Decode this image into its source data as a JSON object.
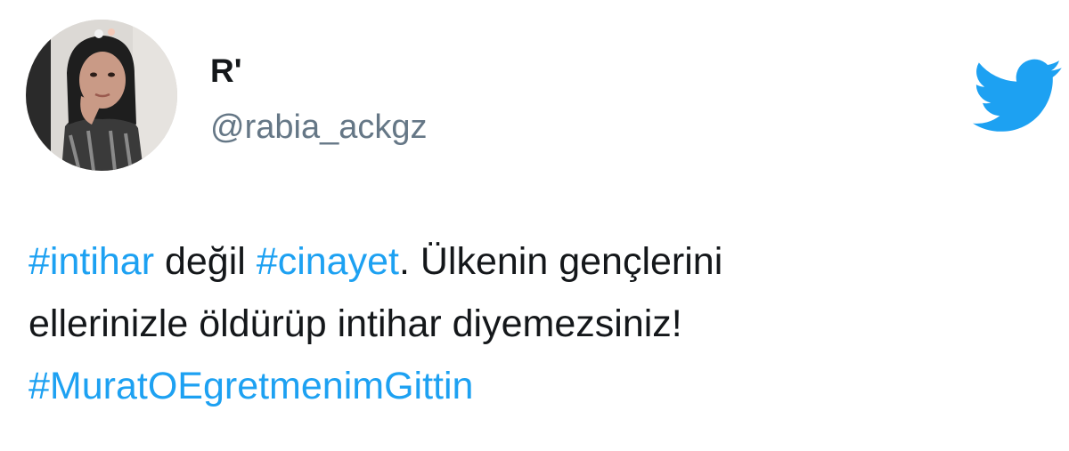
{
  "tweet": {
    "display_name": "R'",
    "handle": "@rabia_ackgz",
    "lines": [
      {
        "hashtag_1": "#intihar",
        "text_1": " değil ",
        "hashtag_2": "#cinayet",
        "text_2": ". Ülkenin gençlerini"
      },
      {
        "text": "ellerinizle öldürüp intihar diyemezsiniz!"
      },
      {
        "hashtag": "#MuratOEgretmenimGittin"
      }
    ]
  },
  "icons": {
    "brand": "twitter-bird-icon",
    "avatar": "profile-photo"
  },
  "colors": {
    "hashtag": "#1da1f2",
    "bird": "#1da1f2",
    "handle": "#657786",
    "text": "#14171a"
  }
}
